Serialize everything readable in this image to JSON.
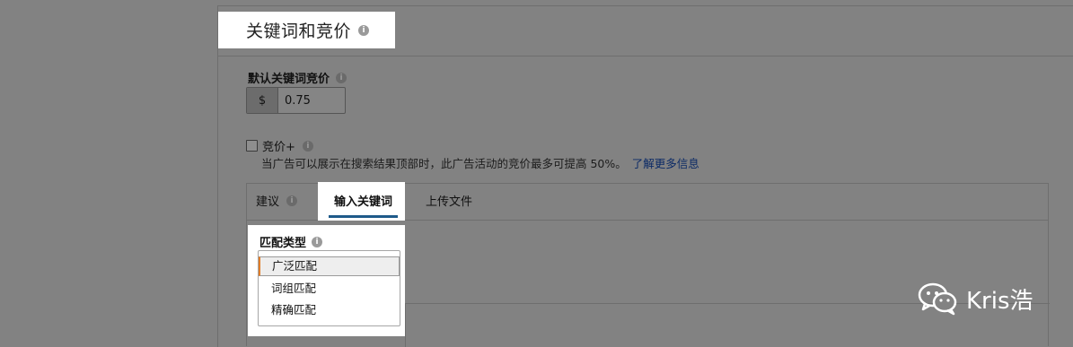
{
  "section": {
    "title": "关键词和竞价"
  },
  "default_bid": {
    "label": "默认关键词竞价",
    "currency": "$",
    "value": "0.75"
  },
  "bid_plus": {
    "label": "竞价+",
    "description": "当广告可以展示在搜索结果顶部时，此广告活动的竞价最多可提高 50%。",
    "link": "了解更多信息"
  },
  "tabs": [
    {
      "label": "建议"
    },
    {
      "label": "输入关键词"
    },
    {
      "label": "上传文件"
    }
  ],
  "match_type": {
    "label": "匹配类型",
    "options": [
      "广泛匹配",
      "词组匹配",
      "精确匹配"
    ],
    "selected_index": 0
  },
  "watermark": {
    "text": "Kris浩"
  },
  "icons": {
    "info": "info-icon",
    "wechat": "wechat-icon"
  },
  "colors": {
    "tab_underline": "#1e5a8a",
    "link": "#0b2a66",
    "selected_accent": "#e17d29"
  }
}
